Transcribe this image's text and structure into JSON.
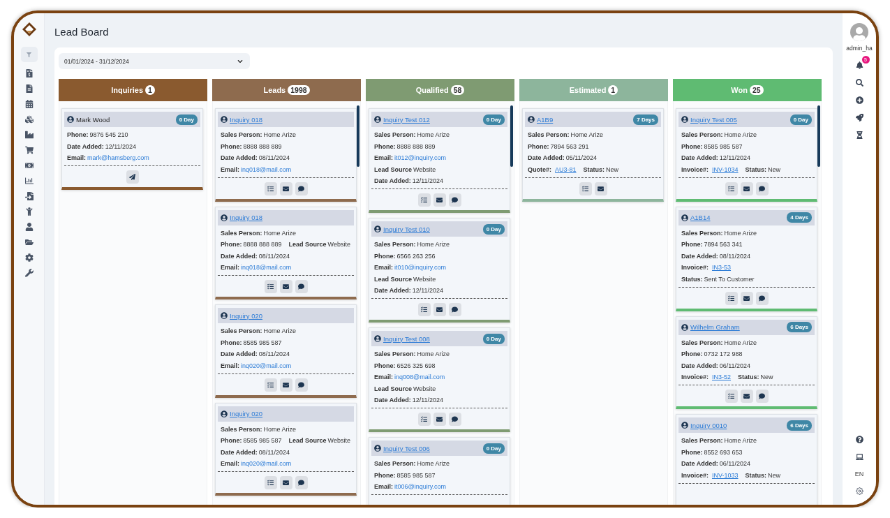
{
  "page_title": "Lead Board",
  "date_range": "01/01/2024 - 31/12/2024",
  "user": {
    "name": "admin_ha",
    "notifications": "5",
    "language": "EN"
  },
  "columns": [
    {
      "title": "Inquiries",
      "count": "1",
      "color": "#8a5a2f",
      "cards": [
        {
          "name": "Mark Wood",
          "name_link": false,
          "badge": "0 Day",
          "rows": [
            [
              {
                "label": "Phone:",
                "value": "9876 545 210",
                "kind": "text"
              }
            ],
            [
              {
                "label": "Date Added:",
                "value": "12/11/2024",
                "kind": "text"
              }
            ],
            [
              {
                "label": "Email:",
                "value": "mark@hamsberg.com",
                "kind": "email"
              }
            ]
          ],
          "actions": [
            {
              "kind": "send"
            }
          ]
        }
      ]
    },
    {
      "title": "Leads",
      "count": "1998",
      "color": "#8e6b4e",
      "cards": [
        {
          "name": "Inquiry 018",
          "name_link": true,
          "rows": [
            [
              {
                "label": "Sales Person:",
                "value": "Home Arize",
                "kind": "text"
              }
            ],
            [
              {
                "label": "Phone:",
                "value": "8888 888 889",
                "kind": "text"
              }
            ],
            [
              {
                "label": "Date Added:",
                "value": "08/11/2024",
                "kind": "text"
              }
            ],
            [
              {
                "label": "Email:",
                "value": "inq018@mail.com",
                "kind": "email"
              }
            ]
          ],
          "actions": [
            {
              "kind": "checklist"
            },
            {
              "kind": "mail"
            },
            {
              "kind": "chat"
            }
          ]
        },
        {
          "name": "Inquiry 018",
          "name_link": true,
          "rows": [
            [
              {
                "label": "Sales Person:",
                "value": "Home Arize",
                "kind": "text"
              }
            ],
            [
              {
                "label": "Phone:",
                "value": "8888 888 889",
                "kind": "text"
              },
              {
                "label": "Lead Source",
                "value": "Website",
                "kind": "text"
              }
            ],
            [
              {
                "label": "Date Added:",
                "value": "08/11/2024",
                "kind": "text"
              }
            ],
            [
              {
                "label": "Email:",
                "value": "inq018@mail.com",
                "kind": "email"
              }
            ]
          ],
          "actions": [
            {
              "kind": "checklist"
            },
            {
              "kind": "mail"
            },
            {
              "kind": "chat"
            }
          ]
        },
        {
          "name": "Inquiry 020",
          "name_link": true,
          "rows": [
            [
              {
                "label": "Sales Person:",
                "value": "Home Arize",
                "kind": "text"
              }
            ],
            [
              {
                "label": "Phone:",
                "value": "8585 985 587",
                "kind": "text"
              }
            ],
            [
              {
                "label": "Date Added:",
                "value": "08/11/2024",
                "kind": "text"
              }
            ],
            [
              {
                "label": "Email:",
                "value": "inq020@mail.com",
                "kind": "email"
              }
            ]
          ],
          "actions": [
            {
              "kind": "checklist"
            },
            {
              "kind": "mail"
            },
            {
              "kind": "chat"
            }
          ]
        },
        {
          "name": "Inquiry 020",
          "name_link": true,
          "rows": [
            [
              {
                "label": "Sales Person:",
                "value": "Home Arize",
                "kind": "text"
              }
            ],
            [
              {
                "label": "Phone:",
                "value": "8585 985 587",
                "kind": "text"
              },
              {
                "label": "Lead Source",
                "value": "Website",
                "kind": "text"
              }
            ],
            [
              {
                "label": "Date Added:",
                "value": "08/11/2024",
                "kind": "text"
              }
            ],
            [
              {
                "label": "Email:",
                "value": "inq020@mail.com",
                "kind": "email"
              }
            ]
          ],
          "actions": [
            {
              "kind": "checklist"
            },
            {
              "kind": "mail"
            },
            {
              "kind": "chat"
            }
          ]
        }
      ]
    },
    {
      "title": "Qualified",
      "count": "58",
      "color": "#7f9b72",
      "cards": [
        {
          "name": "Inquiry Test 012",
          "name_link": true,
          "badge": "0 Day",
          "rows": [
            [
              {
                "label": "Sales Person:",
                "value": "Home Arize",
                "kind": "text"
              }
            ],
            [
              {
                "label": "Phone:",
                "value": "8888 888 889",
                "kind": "text"
              }
            ],
            [
              {
                "label": "Email:",
                "value": "it012@inquiry.com",
                "kind": "email"
              }
            ],
            [
              {
                "label": "Lead Source",
                "value": "Website",
                "kind": "text"
              }
            ],
            [
              {
                "label": "Date Added:",
                "value": "12/11/2024",
                "kind": "text"
              }
            ]
          ],
          "actions": [
            {
              "kind": "checklist"
            },
            {
              "kind": "mail"
            },
            {
              "kind": "chat"
            }
          ]
        },
        {
          "name": "Inquiry Test 010",
          "name_link": true,
          "badge": "0 Day",
          "rows": [
            [
              {
                "label": "Sales Person:",
                "value": "Home Arize",
                "kind": "text"
              }
            ],
            [
              {
                "label": "Phone:",
                "value": "6566 263 256",
                "kind": "text"
              }
            ],
            [
              {
                "label": "Email:",
                "value": "it010@inquiry.com",
                "kind": "email"
              }
            ],
            [
              {
                "label": "Lead Source",
                "value": "Website",
                "kind": "text"
              }
            ],
            [
              {
                "label": "Date Added:",
                "value": "12/11/2024",
                "kind": "text"
              }
            ]
          ],
          "actions": [
            {
              "kind": "checklist"
            },
            {
              "kind": "mail"
            },
            {
              "kind": "chat"
            }
          ]
        },
        {
          "name": "Inquiry Test 008",
          "name_link": true,
          "badge": "0 Day",
          "rows": [
            [
              {
                "label": "Sales Person:",
                "value": "Home Arize",
                "kind": "text"
              }
            ],
            [
              {
                "label": "Phone:",
                "value": "6526 325 698",
                "kind": "text"
              }
            ],
            [
              {
                "label": "Email:",
                "value": "inq008@mail.com",
                "kind": "email"
              }
            ],
            [
              {
                "label": "Lead Source",
                "value": "Website",
                "kind": "text"
              }
            ],
            [
              {
                "label": "Date Added:",
                "value": "12/11/2024",
                "kind": "text"
              }
            ]
          ],
          "actions": [
            {
              "kind": "checklist"
            },
            {
              "kind": "mail"
            },
            {
              "kind": "chat"
            }
          ]
        },
        {
          "name": "Inquiry Test 006",
          "name_link": true,
          "badge": "0 Day",
          "rows": [
            [
              {
                "label": "Sales Person:",
                "value": "Home Arize",
                "kind": "text"
              }
            ],
            [
              {
                "label": "Phone:",
                "value": "8585 985 587",
                "kind": "text"
              }
            ],
            [
              {
                "label": "Email:",
                "value": "it006@inquiry.com",
                "kind": "email"
              }
            ]
          ]
        }
      ]
    },
    {
      "title": "Estimated",
      "count": "1",
      "color": "#8db59c",
      "cards": [
        {
          "name": "A1B9",
          "name_link": true,
          "badge": "7 Days",
          "rows": [
            [
              {
                "label": "Sales Person:",
                "value": "Home Arize",
                "kind": "text"
              }
            ],
            [
              {
                "label": "Phone:",
                "value": "7894 563 291",
                "kind": "text"
              }
            ],
            [
              {
                "label": "Date Added:",
                "value": "05/11/2024",
                "kind": "text"
              }
            ],
            [
              {
                "label": "Quote#:",
                "value": "AU3-81",
                "kind": "link"
              },
              {
                "label": "Status:",
                "value": "New",
                "kind": "text"
              }
            ]
          ],
          "actions": [
            {
              "kind": "checklist"
            },
            {
              "kind": "mail"
            }
          ]
        }
      ]
    },
    {
      "title": "Won",
      "count": "25",
      "color": "#5fbb72",
      "cards": [
        {
          "name": "Inquiry Test 005",
          "name_link": true,
          "badge": "0 Day",
          "rows": [
            [
              {
                "label": "Sales Person:",
                "value": "Home Arize",
                "kind": "text"
              }
            ],
            [
              {
                "label": "Phone:",
                "value": "8585 985 587",
                "kind": "text"
              }
            ],
            [
              {
                "label": "Date Added:",
                "value": "12/11/2024",
                "kind": "text"
              }
            ],
            [
              {
                "label": "Invoice#:",
                "value": "INV-1034",
                "kind": "link"
              },
              {
                "label": "Status:",
                "value": "New",
                "kind": "text"
              }
            ]
          ],
          "actions": [
            {
              "kind": "checklist"
            },
            {
              "kind": "mail"
            },
            {
              "kind": "chat"
            }
          ]
        },
        {
          "name": "A1B14",
          "name_link": true,
          "badge": "4 Days",
          "rows": [
            [
              {
                "label": "Sales Person:",
                "value": "Home Arize",
                "kind": "text"
              }
            ],
            [
              {
                "label": "Phone:",
                "value": "7894 563 341",
                "kind": "text"
              }
            ],
            [
              {
                "label": "Date Added:",
                "value": "08/11/2024",
                "kind": "text"
              }
            ],
            [
              {
                "label": "Invoice#:",
                "value": "IN3-53",
                "kind": "link"
              }
            ],
            [
              {
                "label": "Status:",
                "value": "Sent To Customer",
                "kind": "text"
              }
            ]
          ],
          "actions": [
            {
              "kind": "checklist"
            },
            {
              "kind": "mail"
            },
            {
              "kind": "chat"
            }
          ]
        },
        {
          "name": "Wilhelm Graham",
          "name_link": true,
          "badge": "6 Days",
          "rows": [
            [
              {
                "label": "Sales Person:",
                "value": "Home Arize",
                "kind": "text"
              }
            ],
            [
              {
                "label": "Phone:",
                "value": "0732 172 988",
                "kind": "text"
              }
            ],
            [
              {
                "label": "Date Added:",
                "value": "06/11/2024",
                "kind": "text"
              }
            ],
            [
              {
                "label": "Invoice#:",
                "value": "IN3-52",
                "kind": "link"
              },
              {
                "label": "Status:",
                "value": "New",
                "kind": "text"
              }
            ]
          ],
          "actions": [
            {
              "kind": "checklist"
            },
            {
              "kind": "mail"
            },
            {
              "kind": "chat"
            }
          ]
        },
        {
          "name": "Inquiry 0010",
          "name_link": true,
          "badge": "6 Days",
          "rows": [
            [
              {
                "label": "Sales Person:",
                "value": "Home Arize",
                "kind": "text"
              }
            ],
            [
              {
                "label": "Phone:",
                "value": "8552 693 653",
                "kind": "text"
              }
            ],
            [
              {
                "label": "Date Added:",
                "value": "06/11/2024",
                "kind": "text"
              }
            ],
            [
              {
                "label": "Invoice#:",
                "value": "INV-1033",
                "kind": "link"
              },
              {
                "label": "Status:",
                "value": "New",
                "kind": "text"
              }
            ]
          ]
        }
      ]
    }
  ]
}
